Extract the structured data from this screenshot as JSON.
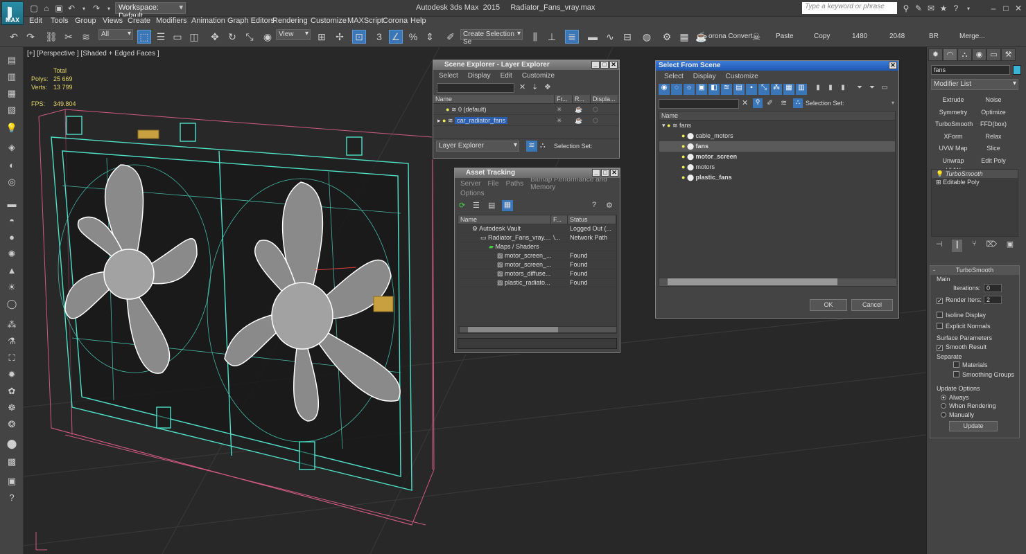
{
  "app": {
    "logo": "MAX",
    "title": "Autodesk 3ds Max  2015     Radiator_Fans_vray.max",
    "workspace": "Workspace: Default",
    "keyword_placeholder": "Type a keyword or phrase"
  },
  "menu": [
    "Edit",
    "Tools",
    "Group",
    "Views",
    "Create",
    "Modifiers",
    "Animation",
    "Graph Editors",
    "Rendering",
    "Customize",
    "MAXScript",
    "Corona",
    "Help"
  ],
  "toolbar": {
    "filter": "All",
    "refcoord": "View",
    "named_sel": "Create Selection Se",
    "corona_convert": "orona Convert",
    "paste": "Paste",
    "copy": "Copy",
    "w": "1480",
    "h": "2048",
    "br": "BR",
    "merge": "Merge..."
  },
  "viewport": {
    "label": "[+] [Perspective ] [Shaded + Edged Faces ]",
    "stats": {
      "total_label": "Total",
      "polys_label": "Polys:",
      "polys": "25 669",
      "verts_label": "Verts:",
      "verts": "13 799",
      "fps_label": "FPS:",
      "fps": "349.804"
    }
  },
  "scene_explorer": {
    "title": "Scene Explorer - Layer Explorer",
    "menu": [
      "Select",
      "Display",
      "Edit",
      "Customize"
    ],
    "cols": [
      "Name",
      "Fr...",
      "R...",
      "Displa..."
    ],
    "rows": [
      "0 (default)",
      "car_radiator_fans"
    ],
    "footer_dropdown": "Layer Explorer",
    "selection_set": "Selection Set:"
  },
  "asset_tracking": {
    "title": "Asset Tracking",
    "menu": [
      "Server",
      "File",
      "Paths",
      "Bitmap Performance and Memory"
    ],
    "menu2": "Options",
    "cols": [
      "Name",
      "F...",
      "Status"
    ],
    "rows": [
      {
        "name": "Autodesk Vault",
        "f": "",
        "status": "Logged Out (..."
      },
      {
        "name": "Radiator_Fans_vray....",
        "f": "\\...",
        "status": "Network Path"
      },
      {
        "name": "Maps / Shaders",
        "f": "",
        "status": ""
      },
      {
        "name": "motor_screen_...",
        "f": "",
        "status": "Found"
      },
      {
        "name": "motor_screen_...",
        "f": "",
        "status": "Found"
      },
      {
        "name": "motors_diffuse...",
        "f": "",
        "status": "Found"
      },
      {
        "name": "plastic_radiato...",
        "f": "",
        "status": "Found"
      }
    ]
  },
  "select_from_scene": {
    "title": "Select From Scene",
    "menu": [
      "Select",
      "Display",
      "Customize"
    ],
    "selection_set": "Selection Set:",
    "col_name": "Name",
    "root": "fans",
    "items": [
      "cable_motors",
      "fans",
      "motor_screen",
      "motors",
      "plastic_fans"
    ],
    "ok": "OK",
    "cancel": "Cancel"
  },
  "command_panel": {
    "name_field": "fans",
    "accent": "#3ab4d4",
    "modifier_list": "Modifier List",
    "mod_buttons": [
      "Extrude",
      "Noise",
      "Symmetry",
      "Optimize",
      "TurboSmooth",
      "FFD(box)",
      "XForm",
      "Relax",
      "UVW Map",
      "Slice",
      "Unwrap UVW",
      "Edit Poly"
    ],
    "stack": [
      "TurboSmooth",
      "Editable Poly"
    ],
    "turbosmooth": {
      "header": "TurboSmooth",
      "main": "Main",
      "iterations_label": "Iterations:",
      "iterations": "0",
      "render_iters_label": "Render Iters:",
      "render_iters": "2",
      "isoline": "Isoline Display",
      "explicit": "Explicit Normals",
      "surface": "Surface Parameters",
      "smooth_result": "Smooth Result",
      "separate": "Separate",
      "materials": "Materials",
      "smoothing_groups": "Smoothing Groups",
      "update_options": "Update Options",
      "always": "Always",
      "when_rendering": "When Rendering",
      "manually": "Manually",
      "update": "Update"
    }
  }
}
